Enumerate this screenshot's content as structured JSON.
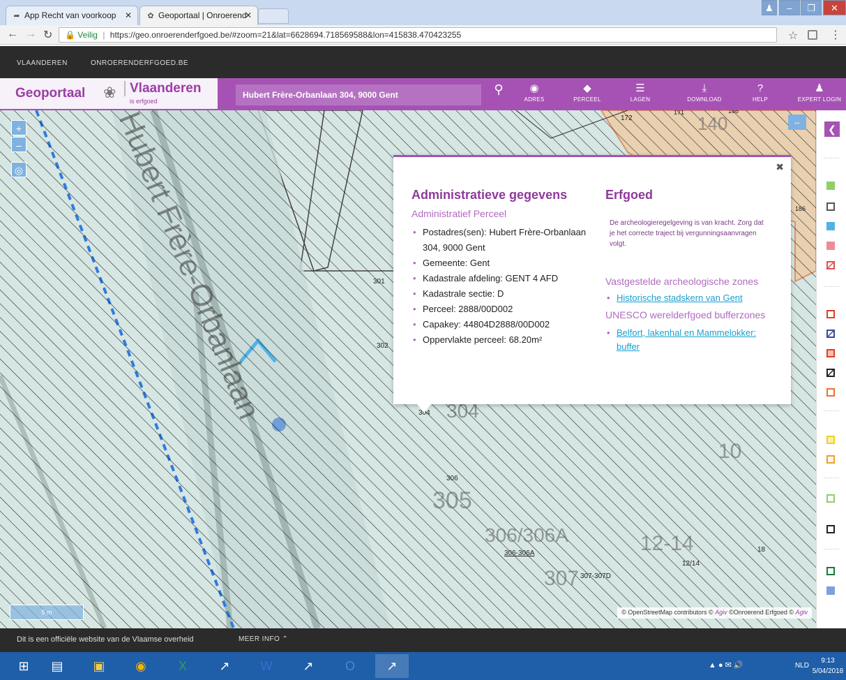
{
  "browser": {
    "tabs": [
      {
        "label": "App Recht van voorkoop",
        "icon": "app-icon"
      },
      {
        "label": "Geoportaal | Onroerend",
        "icon": "erfgoed-favicon"
      }
    ],
    "url_secure_label": "Veilig",
    "url": "https://geo.onroerenderfgoed.be/#zoom=21&lat=6628694.718569588&lon=415838.470423255"
  },
  "site": {
    "top_nav": [
      "VLAANDEREN",
      "ONROERENDERFGOED.BE"
    ],
    "brand_title": "Geoportaal",
    "brand_vlaanderen": "Vlaanderen",
    "brand_erfgoed": "is erfgoed",
    "search_value": "Hubert Frère-Orbanlaan 304, 9000 Gent",
    "tools": [
      {
        "label": "ADRES",
        "icon": "pin-icon"
      },
      {
        "label": "PERCEEL",
        "icon": "parcel-icon"
      },
      {
        "label": "LAGEN",
        "icon": "layers-icon"
      },
      {
        "label": "DOWNLOAD",
        "icon": "download-icon"
      },
      {
        "label": "HELP",
        "icon": "help-icon"
      },
      {
        "label": "EXPERT LOGIN",
        "icon": "user-icon"
      }
    ]
  },
  "map": {
    "street_label": "Hubert Frère-Orbanlaan",
    "parcel_labels": [
      "301",
      "302",
      "304",
      "304",
      "305",
      "306",
      "306-306A",
      "306/306A",
      "307",
      "307-307D",
      "12-14",
      "12/14",
      "18",
      "10",
      "172",
      "171",
      "168",
      "140",
      "186"
    ],
    "attribution_osm": "© OpenStreetMap contributors ©",
    "attribution_agiv1": "Agiv",
    "attribution_oe": "©Onroerend Erfgoed ©",
    "attribution_agiv2": "Agiv",
    "scale_label": "5 m"
  },
  "popup": {
    "admin_title": "Administratieve gegevens",
    "admin_subtitle": "Administratief Perceel",
    "admin_items": [
      "Postadres(sen): Hubert Frère-Orbanlaan 304, 9000 Gent",
      "Gemeente: Gent",
      "Kadastrale afdeling: GENT 4 AFD",
      "Kadastrale sectie: D",
      "Perceel: 2888/00D002",
      "Capakey: 44804D2888/00D002",
      "Oppervlakte perceel: 68.20m²"
    ],
    "erfgoed_title": "Erfgoed",
    "erfgoed_note": "De archeologieregelgeving is van kracht. Zorg dat je het correcte traject bij vergunningsaanvragen volgt.",
    "zones_title": "Vastgestelde archeologische zones",
    "zones_link": "Historische stadskern van Gent",
    "unesco_title": "UNESCO werelderfgoed bufferzones",
    "unesco_link": "Belfort, lakenhal en Mammelokker: buffer"
  },
  "footer": {
    "text": "Dit is een officiële website van de Vlaamse overheid",
    "more": "MEER INFO"
  },
  "taskbar": {
    "apps": [
      "windows-start-icon",
      "file-explorer-icon",
      "folder-icon",
      "chrome-icon",
      "excel-icon",
      "app-icon",
      "word-icon",
      "app-icon",
      "outlook-icon",
      "app-icon"
    ],
    "language": "NLD",
    "time": "9:13",
    "date": "5/04/2018"
  },
  "colors": {
    "brand_purple": "#a652b4",
    "link_blue": "#1a9fd0",
    "map_hatch": "#1a1a1a",
    "map_fill": "#d6e6e3",
    "protected_orange": "#e07b3c"
  },
  "legend_swatches": [
    {
      "color": "#8fcf66",
      "style": "fill"
    },
    {
      "color": "#555555",
      "style": "outline"
    },
    {
      "color": "#4fb3e8",
      "style": "fill"
    },
    {
      "color": "#f08a99",
      "style": "fill"
    },
    {
      "color": "#e05050",
      "style": "hatch"
    },
    {
      "color": "#e04020",
      "style": "outline"
    },
    {
      "color": "#3b4a9a",
      "style": "hatch"
    },
    {
      "color": "#e04020",
      "style": "fill-light"
    },
    {
      "color": "#222222",
      "style": "hatch"
    },
    {
      "color": "#f07030",
      "style": "outline"
    },
    {
      "color": "#f0d020",
      "style": "fill-light"
    },
    {
      "color": "#f0a020",
      "style": "outline"
    },
    {
      "color": "#8fcf66",
      "style": "dashed"
    },
    {
      "color": "#222222",
      "style": "outline"
    },
    {
      "color": "#1a7a3a",
      "style": "outline"
    },
    {
      "color": "#7f9ee0",
      "style": "fill"
    }
  ]
}
